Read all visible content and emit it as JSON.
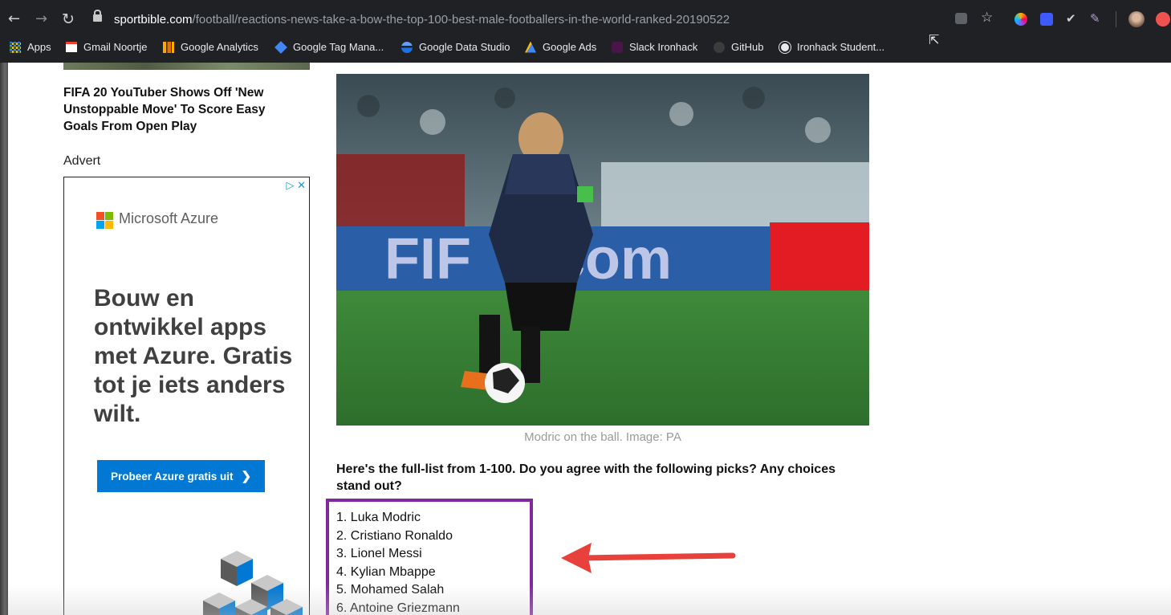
{
  "browser": {
    "url_host": "sportbible.com",
    "url_path": "/football/reactions-news-take-a-bow-the-top-100-best-male-footballers-in-the-world-ranked-20190522",
    "bookmarks": [
      "Apps",
      "Gmail Noortje",
      "Google Analytics",
      "Google Tag Mana...",
      "Google Data Studio",
      "Google Ads",
      "Slack Ironhack",
      "GitHub",
      "Ironhack Student..."
    ]
  },
  "sidebar": {
    "related_title": "FIFA 20 YouTuber Shows Off 'New Unstoppable Move' To Score Easy Goals From Open Play",
    "advert_label": "Advert",
    "ad": {
      "brand": "Microsoft Azure",
      "headline": "Bouw en ontwikkel apps met Azure. Gratis tot je iets anders wilt.",
      "cta": "Probeer Azure gratis uit"
    }
  },
  "article": {
    "image_caption": "Modric on the ball. Image: PA",
    "intro": "Here's the full-list from 1-100. Do you agree with the following picks? Any choices stand out?",
    "players": [
      "1. Luka Modric",
      "2. Cristiano Ronaldo",
      "3. Lionel Messi",
      "4. Kylian Mbappe",
      "5. Mohamed Salah",
      "6. Antoine Griezmann"
    ]
  },
  "colors": {
    "highlight_box": "#7f2a9c",
    "arrow": "#e8403a",
    "ad_button": "#0078d4"
  }
}
